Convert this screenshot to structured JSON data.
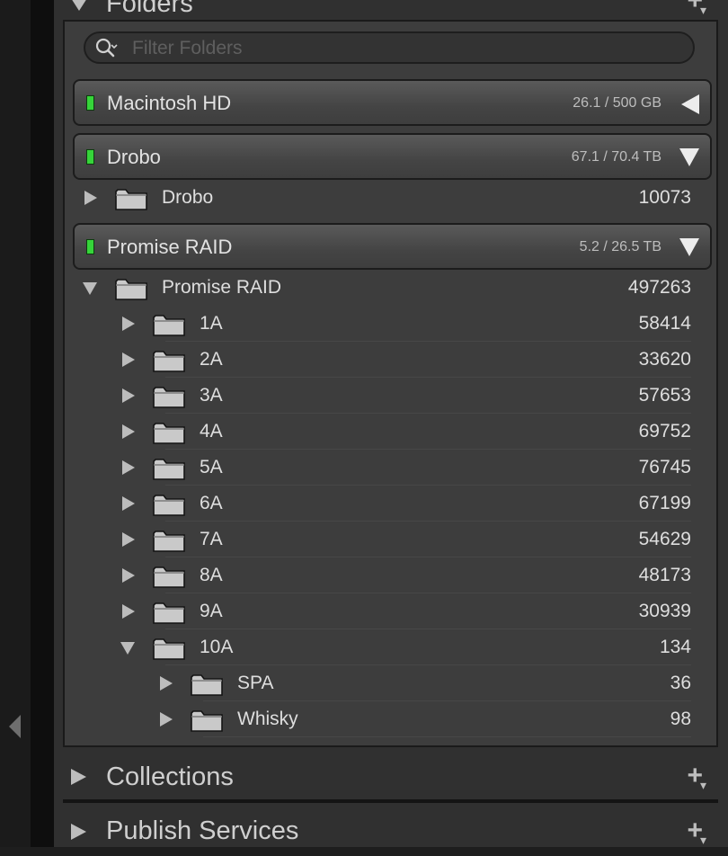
{
  "folders_panel": {
    "title": "Folders",
    "filter_placeholder": "Filter Folders"
  },
  "volumes": [
    {
      "name": "Macintosh HD",
      "size": "26.1 / 500 GB",
      "state": "collapsed",
      "led_color": "#36d43a"
    },
    {
      "name": "Drobo",
      "size": "67.1 / 70.4 TB",
      "state": "expanded",
      "led_color": "#36d43a"
    },
    {
      "name": "Promise RAID",
      "size": "5.2 / 26.5 TB",
      "state": "expanded",
      "led_color": "#36d43a"
    }
  ],
  "folders": [
    {
      "name": "Drobo",
      "count": "10073",
      "level": 0,
      "expanded": false
    },
    {
      "name": "Promise RAID",
      "count": "497263",
      "level": 0,
      "expanded": true
    },
    {
      "name": "1A",
      "count": "58414",
      "level": 1,
      "expanded": false
    },
    {
      "name": "2A",
      "count": "33620",
      "level": 1,
      "expanded": false
    },
    {
      "name": "3A",
      "count": "57653",
      "level": 1,
      "expanded": false
    },
    {
      "name": "4A",
      "count": "69752",
      "level": 1,
      "expanded": false
    },
    {
      "name": "5A",
      "count": "76745",
      "level": 1,
      "expanded": false
    },
    {
      "name": "6A",
      "count": "67199",
      "level": 1,
      "expanded": false
    },
    {
      "name": "7A",
      "count": "54629",
      "level": 1,
      "expanded": false
    },
    {
      "name": "8A",
      "count": "48173",
      "level": 1,
      "expanded": false
    },
    {
      "name": "9A",
      "count": "30939",
      "level": 1,
      "expanded": false
    },
    {
      "name": "10A",
      "count": "134",
      "level": 1,
      "expanded": true
    },
    {
      "name": "SPA",
      "count": "36",
      "level": 2,
      "expanded": false
    },
    {
      "name": "Whisky",
      "count": "98",
      "level": 2,
      "expanded": false
    }
  ],
  "collections_panel": {
    "title": "Collections",
    "add_symbol": "+"
  },
  "publish_panel": {
    "title": "Publish Services",
    "add_symbol": "+"
  },
  "icons": {
    "volume_led": "green-led-icon",
    "folder": "folder-icon",
    "filter": "search-icon",
    "add": "plus-icon"
  }
}
